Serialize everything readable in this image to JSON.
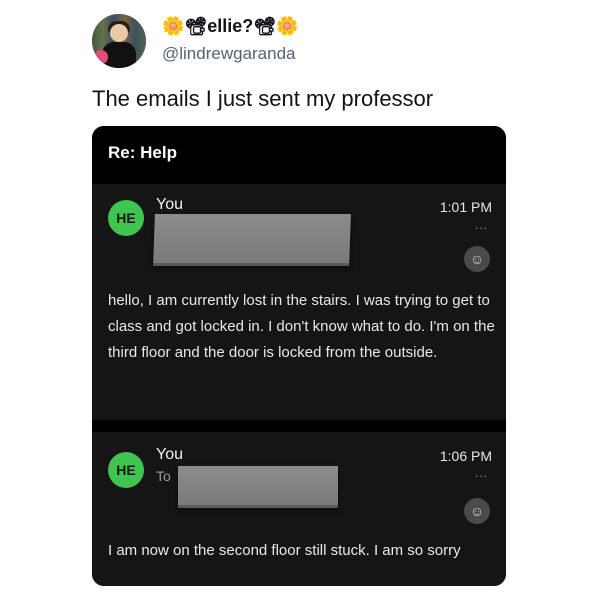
{
  "tweet": {
    "display_name": "🌼📽ellie?📽🌼",
    "handle": "@lindrewgaranda",
    "text": "The emails I just sent my professor"
  },
  "email": {
    "subject": "Re: Help",
    "messages": [
      {
        "initials": "HE",
        "sender": "You",
        "time": "1:01 PM",
        "more": "...",
        "body": "hello, I am currently lost in the stairs. I was trying to get to class and got locked in. I don't know what to do. I'm on the third floor and the door is locked from the outside."
      },
      {
        "initials": "HE",
        "sender": "You",
        "to_label": "To",
        "time": "1:06 PM",
        "more": "...",
        "body": "I am now on the second floor still stuck. I am so sorry"
      }
    ]
  },
  "icons": {
    "more": "more-horizontal-icon",
    "emoji": "emoji-reaction-icon"
  },
  "colors": {
    "avatar_green": "#3ec44f",
    "card_background": "#000000",
    "message_background": "#151515"
  }
}
